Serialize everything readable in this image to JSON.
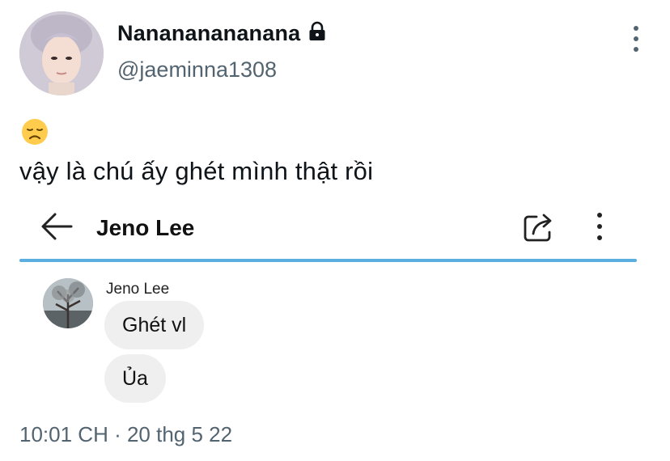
{
  "tweet": {
    "display_name": "Nanananananana",
    "handle": "@jaeminna1308",
    "emoji": "😞",
    "text": "vậy là chú ấy ghét mình thật rồi",
    "timestamp": "10:01 CH · 20 thg 5 22"
  },
  "icons": {
    "lock": "lock-icon",
    "more": "more-vertical-icon",
    "emoji": "disappointed-face-icon"
  },
  "screenshot": {
    "title": "Jeno Lee",
    "back_icon": "back-arrow-icon",
    "share_icon": "share-icon",
    "more_icon": "more-vertical-icon",
    "divider_color": "#5aaee0",
    "message_sender": "Jeno Lee",
    "messages": [
      "Ghét vl",
      "Ủa"
    ]
  },
  "colors": {
    "text_primary": "#0f1419",
    "text_secondary": "#536471",
    "bubble_bg": "#efefef"
  }
}
